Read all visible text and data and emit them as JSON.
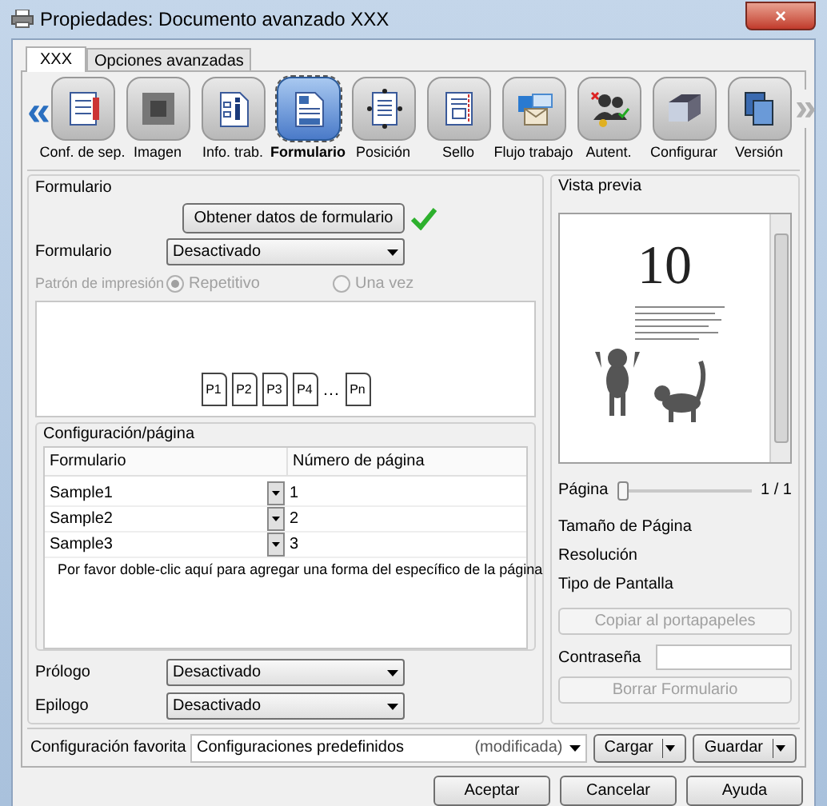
{
  "window": {
    "title": "Propiedades: Documento avanzado XXX",
    "close": "×"
  },
  "tabs": [
    {
      "label": "XXX",
      "selected": true
    },
    {
      "label": "Opciones avanzadas",
      "selected": false
    }
  ],
  "toolbar": {
    "prev": "«",
    "next": "»",
    "items": [
      {
        "label": "Conf. de sep.",
        "selected": false
      },
      {
        "label": "Imagen",
        "selected": false
      },
      {
        "label": "Info. trab.",
        "selected": false
      },
      {
        "label": "Formulario",
        "selected": true
      },
      {
        "label": "Posición",
        "selected": false
      },
      {
        "label": "Sello",
        "selected": false
      },
      {
        "label": "Flujo trabajo",
        "selected": false
      },
      {
        "label": "Autent.",
        "selected": false
      },
      {
        "label": "Configurar",
        "selected": false
      },
      {
        "label": "Versión",
        "selected": false
      }
    ]
  },
  "form_section": {
    "title": "Formulario",
    "fetch_button": "Obtener datos de formulario",
    "formulario": {
      "label": "Formulario",
      "value": "Desactivado"
    },
    "print_pattern": {
      "label": "Patrón de impresión",
      "disabled": true,
      "options": [
        {
          "label": "Repetitivo",
          "selected": true
        },
        {
          "label": "Una vez",
          "selected": false
        }
      ]
    },
    "pages": [
      "P1",
      "P2",
      "P3",
      "P4",
      "Pn"
    ],
    "ellipsis": "…"
  },
  "page_config": {
    "title": "Configuración/página",
    "columns": [
      "Formulario",
      "Número de página"
    ],
    "rows": [
      {
        "form": "Sample1",
        "page": "1"
      },
      {
        "form": "Sample2",
        "page": "2"
      },
      {
        "form": "Sample3",
        "page": "3"
      }
    ],
    "hint": "Por favor doble-clic aquí para agregar una forma del específico de la página"
  },
  "prologue": {
    "label": "Prólogo",
    "value": "Desactivado"
  },
  "epilogue": {
    "label": "Epilogo",
    "value": "Desactivado"
  },
  "preview": {
    "title": "Vista previa",
    "page_number": "10",
    "page_label": "Página",
    "level": 0,
    "page_reading": "1 / 1",
    "info": [
      "Tamaño de Página",
      "Resolución",
      "Tipo de Pantalla"
    ],
    "copy_button": {
      "label": "Copiar al portapapeles",
      "disabled": true
    },
    "password_label": "Contraseña",
    "clear_button": {
      "label": "Borrar Formulario",
      "disabled": true
    }
  },
  "favorites": {
    "label": "Configuración favorita",
    "value": "Configuraciones predefinidos",
    "status": "(modificada)",
    "load_button": "Cargar",
    "save_button": "Guardar"
  },
  "buttons": [
    "Aceptar",
    "Cancelar",
    "Ayuda"
  ]
}
